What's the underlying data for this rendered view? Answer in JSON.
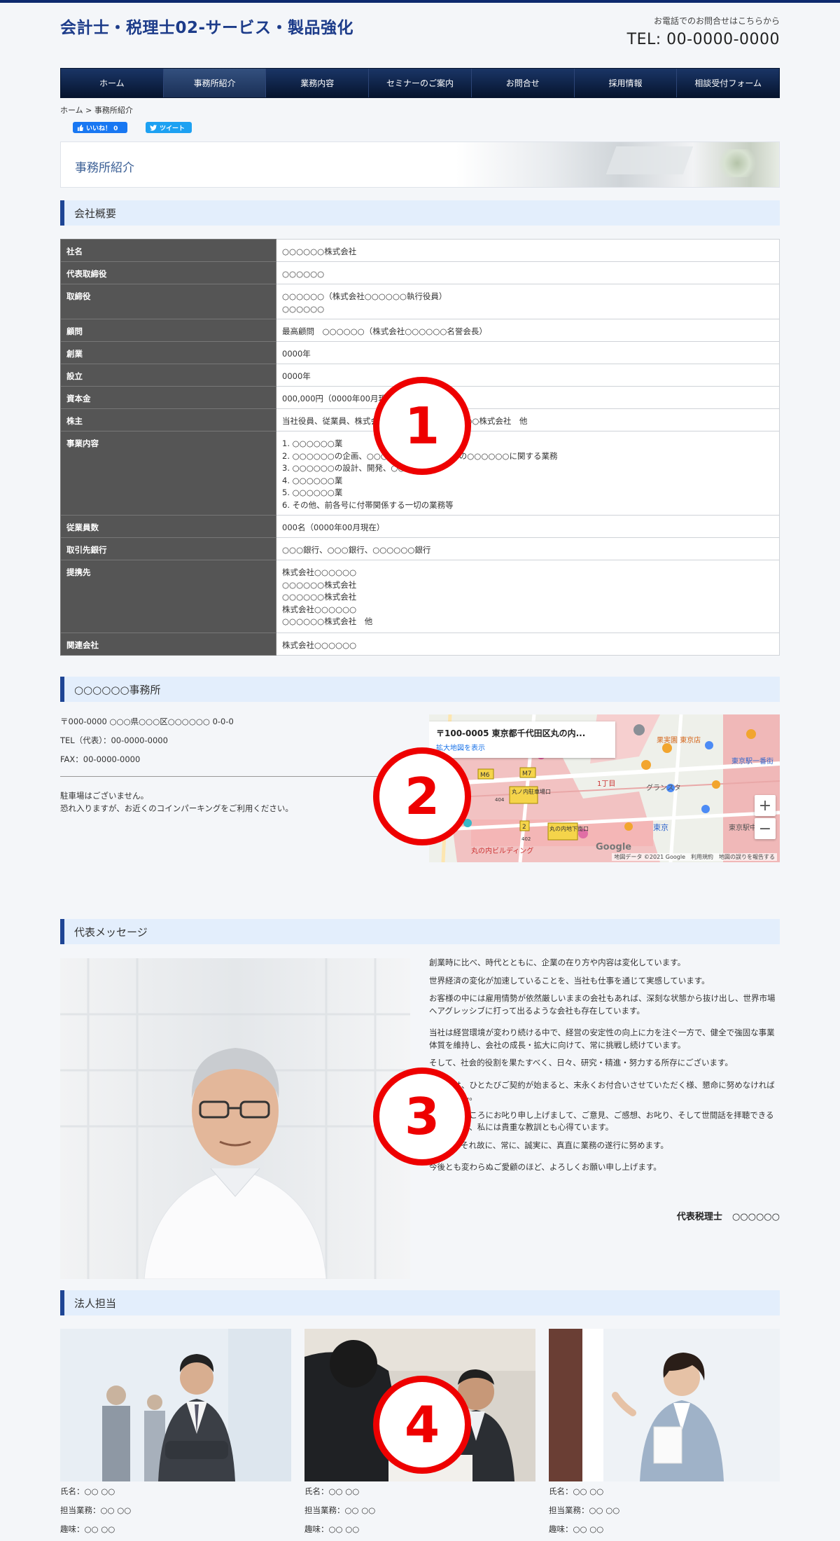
{
  "header": {
    "site_title": "会計士・税理士02-サービス・製品強化",
    "contact_note": "お電話でのお問合せはこちらから",
    "tel": "TEL: 00-0000-0000"
  },
  "nav": [
    "ホーム",
    "事務所紹介",
    "業務内容",
    "セミナーのご案内",
    "お問合せ",
    "採用情報",
    "相談受付フォーム"
  ],
  "breadcrumb": {
    "home": "ホーム",
    "sep": " > ",
    "current": "事務所紹介"
  },
  "social": {
    "like": "いいね！ 0",
    "tweet": "ツイート"
  },
  "page_title": "事務所紹介",
  "overview": {
    "heading": "会社概要",
    "rows": [
      {
        "label": "社名",
        "value": "○○○○○○株式会社"
      },
      {
        "label": "代表取締役",
        "value": "○○○○○○"
      },
      {
        "label": "取締役",
        "value": "○○○○○○（株式会社○○○○○○執行役員）\n○○○○○○"
      },
      {
        "label": "顧問",
        "value": "最高顧問　○○○○○○（株式会社○○○○○○名誉会長）"
      },
      {
        "label": "創業",
        "value": "0000年"
      },
      {
        "label": "設立",
        "value": "0000年"
      },
      {
        "label": "資本金",
        "value": "000,000円（0000年00月現在）"
      },
      {
        "label": "株主",
        "value": "当社役員、従業員、株式会社○○○○○○、○○○○○○株式会社　他"
      },
      {
        "label": "事業内容",
        "value": "1. ○○○○○○業\n2. ○○○○○○の企画、○○○○○○、○○○○○○の○○○○○○に関する業務\n3. ○○○○○○の設計、開発、○○○○○○\n4. ○○○○○○業\n5. ○○○○○○業\n6. その他、前各号に付帯関係する一切の業務等"
      },
      {
        "label": "従業員数",
        "value": "000名（0000年00月現在）"
      },
      {
        "label": "取引先銀行",
        "value": "○○○銀行、○○○銀行、○○○○○○銀行"
      },
      {
        "label": "提携先",
        "value": "株式会社○○○○○○\n○○○○○○株式会社\n○○○○○○株式会社\n株式会社○○○○○○\n○○○○○○株式会社　他"
      },
      {
        "label": "関連会社",
        "value": "株式会社○○○○○○"
      }
    ]
  },
  "office": {
    "heading": "○○○○○○事務所",
    "address": "〒000-0000 ○○○県○○○区○○○○○○ 0-0-0",
    "tel": "TEL（代表）：00-0000-0000",
    "fax": "FAX：00-0000-0000",
    "parking1": "駐車場はございません。",
    "parking2": "恐れ入りますが、お近くのコインパーキングをご利用ください。",
    "map": {
      "card_address": "〒100-0005 東京都千代田区丸の内...",
      "card_link": "拡大地図を表示",
      "labels": [
        "M6",
        "M7",
        "丸ノ内駐車場口",
        "1丁目",
        "丸の内地下南口",
        "東京駅一番街",
        "グランスタ",
        "丸の内ビルディング",
        "東京",
        "東京駅中央口",
        "果実園 東京店",
        "2",
        "402",
        "404"
      ],
      "attribution": "地図データ ©2021 Google　利用規約　地図の誤りを報告する",
      "logo": "Google"
    }
  },
  "message": {
    "heading": "代表メッセージ",
    "paragraphs": [
      "創業時に比べ、時代とともに、企業の在り方や内容は変化しています。",
      "世界経済の変化が加速していることを、当社も仕事を通じて実感しています。",
      "お客様の中には雇用情勢が依然厳しいままの会社もあれば、深刻な状態から抜け出し、世界市場へアグレッシブに打って出るような会社も存在しています。",
      "当社は経営環境が変わり続ける中で、経営の安定性の向上に力を注ぐ一方で、健全で強固な事業体質を維持し、会社の成長・拡大に向けて、常に挑戦し続けています。",
      "そして、社会的役割を果たすべく、日々、研究・精進・努力する所存にございます。",
      "私どもは、ひとたびご契約が始まると、末永くお付合いさせていただく様、懇命に努めなければなりません。",
      "至らないところにお叱り申し上げまして、ご意見、ご感想、お叱り、そして世間話を拝聴できることこそが、私には貴重な教訓とも心得ています。",
      "そして、それ故に、常に、誠実に、真直に業務の遂行に努めます。",
      "今後とも変わらぬご愛顧のほど、よろしくお願い申し上げます。"
    ],
    "signature_title": "代表税理士",
    "signature_name": "○○○○○○"
  },
  "corporate": {
    "heading": "法人担当",
    "staff": [
      {
        "name": "氏名：○○ ○○",
        "duty": "担当業務：○○ ○○",
        "hobby": "趣味：○○ ○○"
      },
      {
        "name": "氏名：○○ ○○",
        "duty": "担当業務：○○ ○○",
        "hobby": "趣味：○○ ○○"
      },
      {
        "name": "氏名：○○ ○○",
        "duty": "担当業務：○○ ○○",
        "hobby": "趣味：○○ ○○"
      }
    ]
  },
  "markers": [
    "1",
    "2",
    "3",
    "4"
  ],
  "colors": {
    "brand": "#1d3c8a",
    "nav": "#0d2a6e",
    "section_bg": "#e3eefc",
    "marker": "#e00000"
  }
}
